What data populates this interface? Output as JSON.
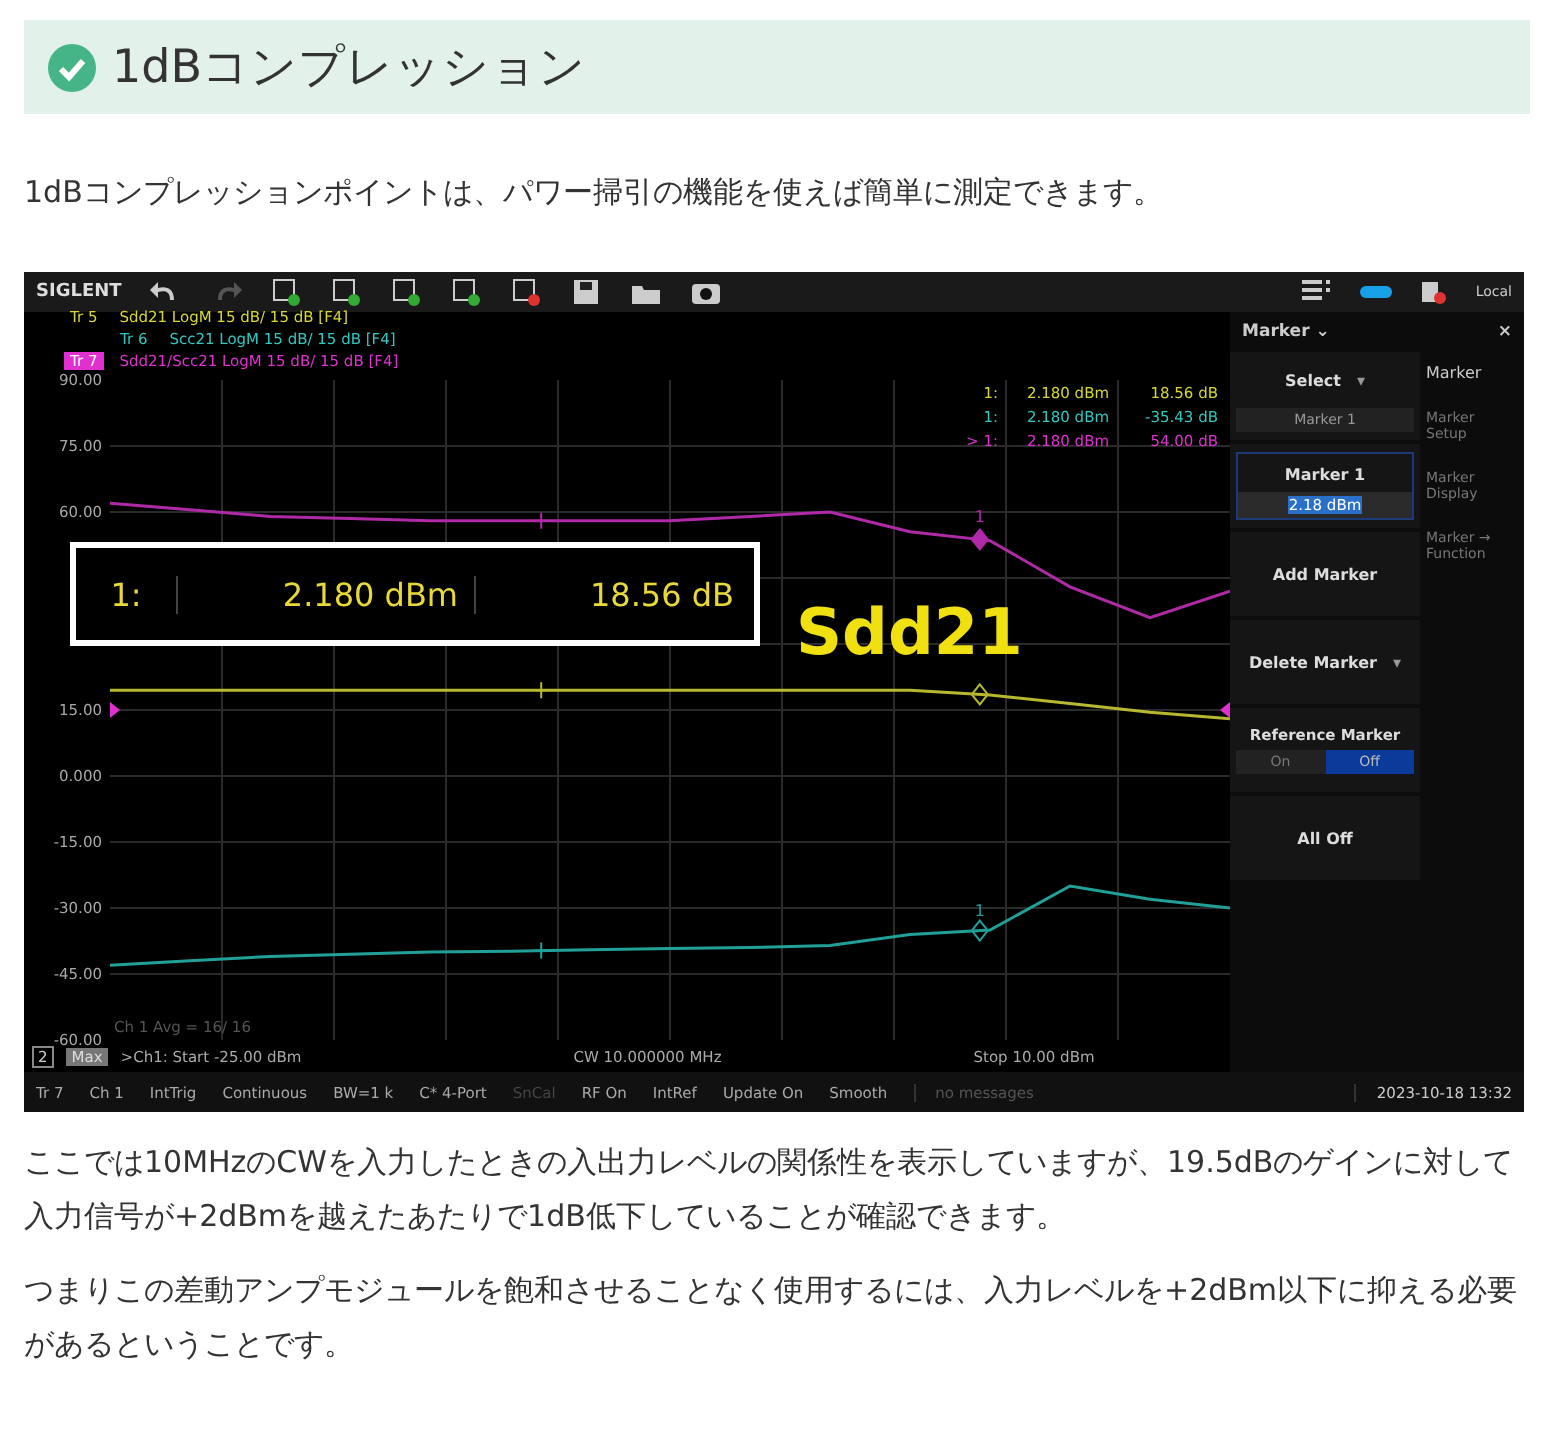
{
  "heading": {
    "text": "1dBコンプレッション"
  },
  "intro": "1dBコンプレッションポイントは、パワー掃引の機能を使えば簡単に測定できます。",
  "instrument": {
    "toolbar": {
      "logo": "SIGLENT",
      "status": "Local"
    },
    "trace_headers": [
      {
        "trace": "Tr 5",
        "text": "Sdd21 LogM 15 dB/ 15 dB [F4]",
        "color": "#d8d830",
        "selected": false
      },
      {
        "trace": "Tr 6",
        "text": "Scc21 LogM 15 dB/ 15 dB [F4]",
        "color": "#30c8c0",
        "selected": false
      },
      {
        "trace": "Tr 7",
        "text": "Sdd21/Scc21 LogM 15 dB/ 15 dB [F4]",
        "color": "#e030d0",
        "selected": true
      }
    ],
    "chart_data": {
      "type": "line",
      "ylim": [
        -60,
        90
      ],
      "grid": true,
      "annotations": [
        {
          "text": "1",
          "y": 54
        },
        {
          "text": "1",
          "y": -35.4
        }
      ],
      "yticks": [
        {
          "value": 90,
          "label": "90.00"
        },
        {
          "value": 75,
          "label": "75.00"
        },
        {
          "value": 60,
          "label": "60.00"
        },
        {
          "value": 15,
          "label": "15.00"
        },
        {
          "value": 0,
          "label": "0.000"
        },
        {
          "value": -15,
          "label": "-15.00"
        },
        {
          "value": -30,
          "label": "-30.00"
        },
        {
          "value": -45,
          "label": "-45.00"
        },
        {
          "value": -60,
          "label": "-60.00"
        }
      ],
      "series": [
        {
          "color": "#b02aa8",
          "values": [
            62,
            60.5,
            59,
            58.5,
            58,
            58,
            58,
            58,
            59,
            60,
            55.5,
            53.5,
            43,
            36,
            42
          ]
        },
        {
          "color": "#b8b830",
          "values": [
            19.5,
            19.5,
            19.5,
            19.5,
            19.5,
            19.5,
            19.5,
            19.5,
            19.5,
            19.5,
            19.5,
            18.4,
            16.5,
            14.5,
            13
          ]
        },
        {
          "color": "#20a098",
          "values": [
            -43,
            -42,
            -41,
            -40.5,
            -40,
            -39.8,
            -39.5,
            -39.2,
            -39,
            -38.5,
            -36,
            -35,
            -25,
            -28,
            -30
          ]
        }
      ]
    },
    "marker_table": [
      {
        "label": "1:",
        "stimulus": "2.180 dBm",
        "response": "18.56 dB",
        "color": "#d8d830"
      },
      {
        "label": "1:",
        "stimulus": "2.180 dBm",
        "response": "-35.43 dB",
        "color": "#30c8c0"
      },
      {
        "label": "> 1:",
        "stimulus": "2.180 dBm",
        "response": "54.00 dB",
        "color": "#e030d0"
      }
    ],
    "readout": {
      "label": "1:",
      "stimulus": "2.180 dBm",
      "response": "18.56 dB"
    },
    "callout": "Sdd21",
    "avg_text": "Ch 1 Avg = 16/ 16",
    "panel": {
      "title": "Marker",
      "title_caret": "⌄",
      "close": "×",
      "controls": [
        {
          "kind": "dropdown",
          "label": "Select",
          "caret": "▾",
          "value": "Marker 1"
        },
        {
          "kind": "input",
          "label": "Marker 1",
          "value": "2.18 dBm"
        },
        {
          "kind": "button",
          "label": "Add Marker"
        },
        {
          "kind": "dropdown",
          "label": "Delete Marker",
          "caret": "▾"
        },
        {
          "kind": "toggle",
          "label": "Reference Marker",
          "options": [
            {
              "label": "On",
              "selected": false
            },
            {
              "label": "Off",
              "selected": true
            }
          ]
        },
        {
          "kind": "button",
          "label": "All Off"
        }
      ],
      "tabs": [
        {
          "label": "Marker",
          "selected": true
        },
        {
          "label": "Marker Setup",
          "selected": false
        },
        {
          "label": "Marker Display",
          "selected": false
        },
        {
          "label": "Marker → Function",
          "selected": false
        }
      ]
    },
    "status": {
      "channel": "2",
      "mode": "Max",
      "start": ">Ch1: Start -25.00 dBm",
      "center": "CW 10.000000 MHz",
      "stop": "Stop 10.00 dBm"
    },
    "bottom_bar": [
      {
        "label": "Tr 7",
        "disabled": false
      },
      {
        "label": "Ch 1",
        "disabled": false
      },
      {
        "label": "IntTrig",
        "disabled": false
      },
      {
        "label": "Continuous",
        "disabled": false
      },
      {
        "label": "BW=1 k",
        "disabled": false
      },
      {
        "label": "C* 4-Port",
        "disabled": false
      },
      {
        "label": "SnCal",
        "disabled": true
      },
      {
        "label": "RF On",
        "disabled": false
      },
      {
        "label": "IntRef",
        "disabled": false
      },
      {
        "label": "Update On",
        "disabled": false
      },
      {
        "label": "Smooth",
        "disabled": false
      }
    ],
    "message": "no messages",
    "datetime": "2023-10-18 13:32"
  },
  "paragraphs": [
    "ここでは10MHzのCWを入力したときの入出力レベルの関係性を表示していますが、19.5dBのゲインに対して入力信号が+2dBmを越えたあたりで1dB低下していることが確認できます。",
    "つまりこの差動アンプモジュールを飽和させることなく使用するには、入力レベルを+2dBm以下に抑える必要があるということです。"
  ]
}
